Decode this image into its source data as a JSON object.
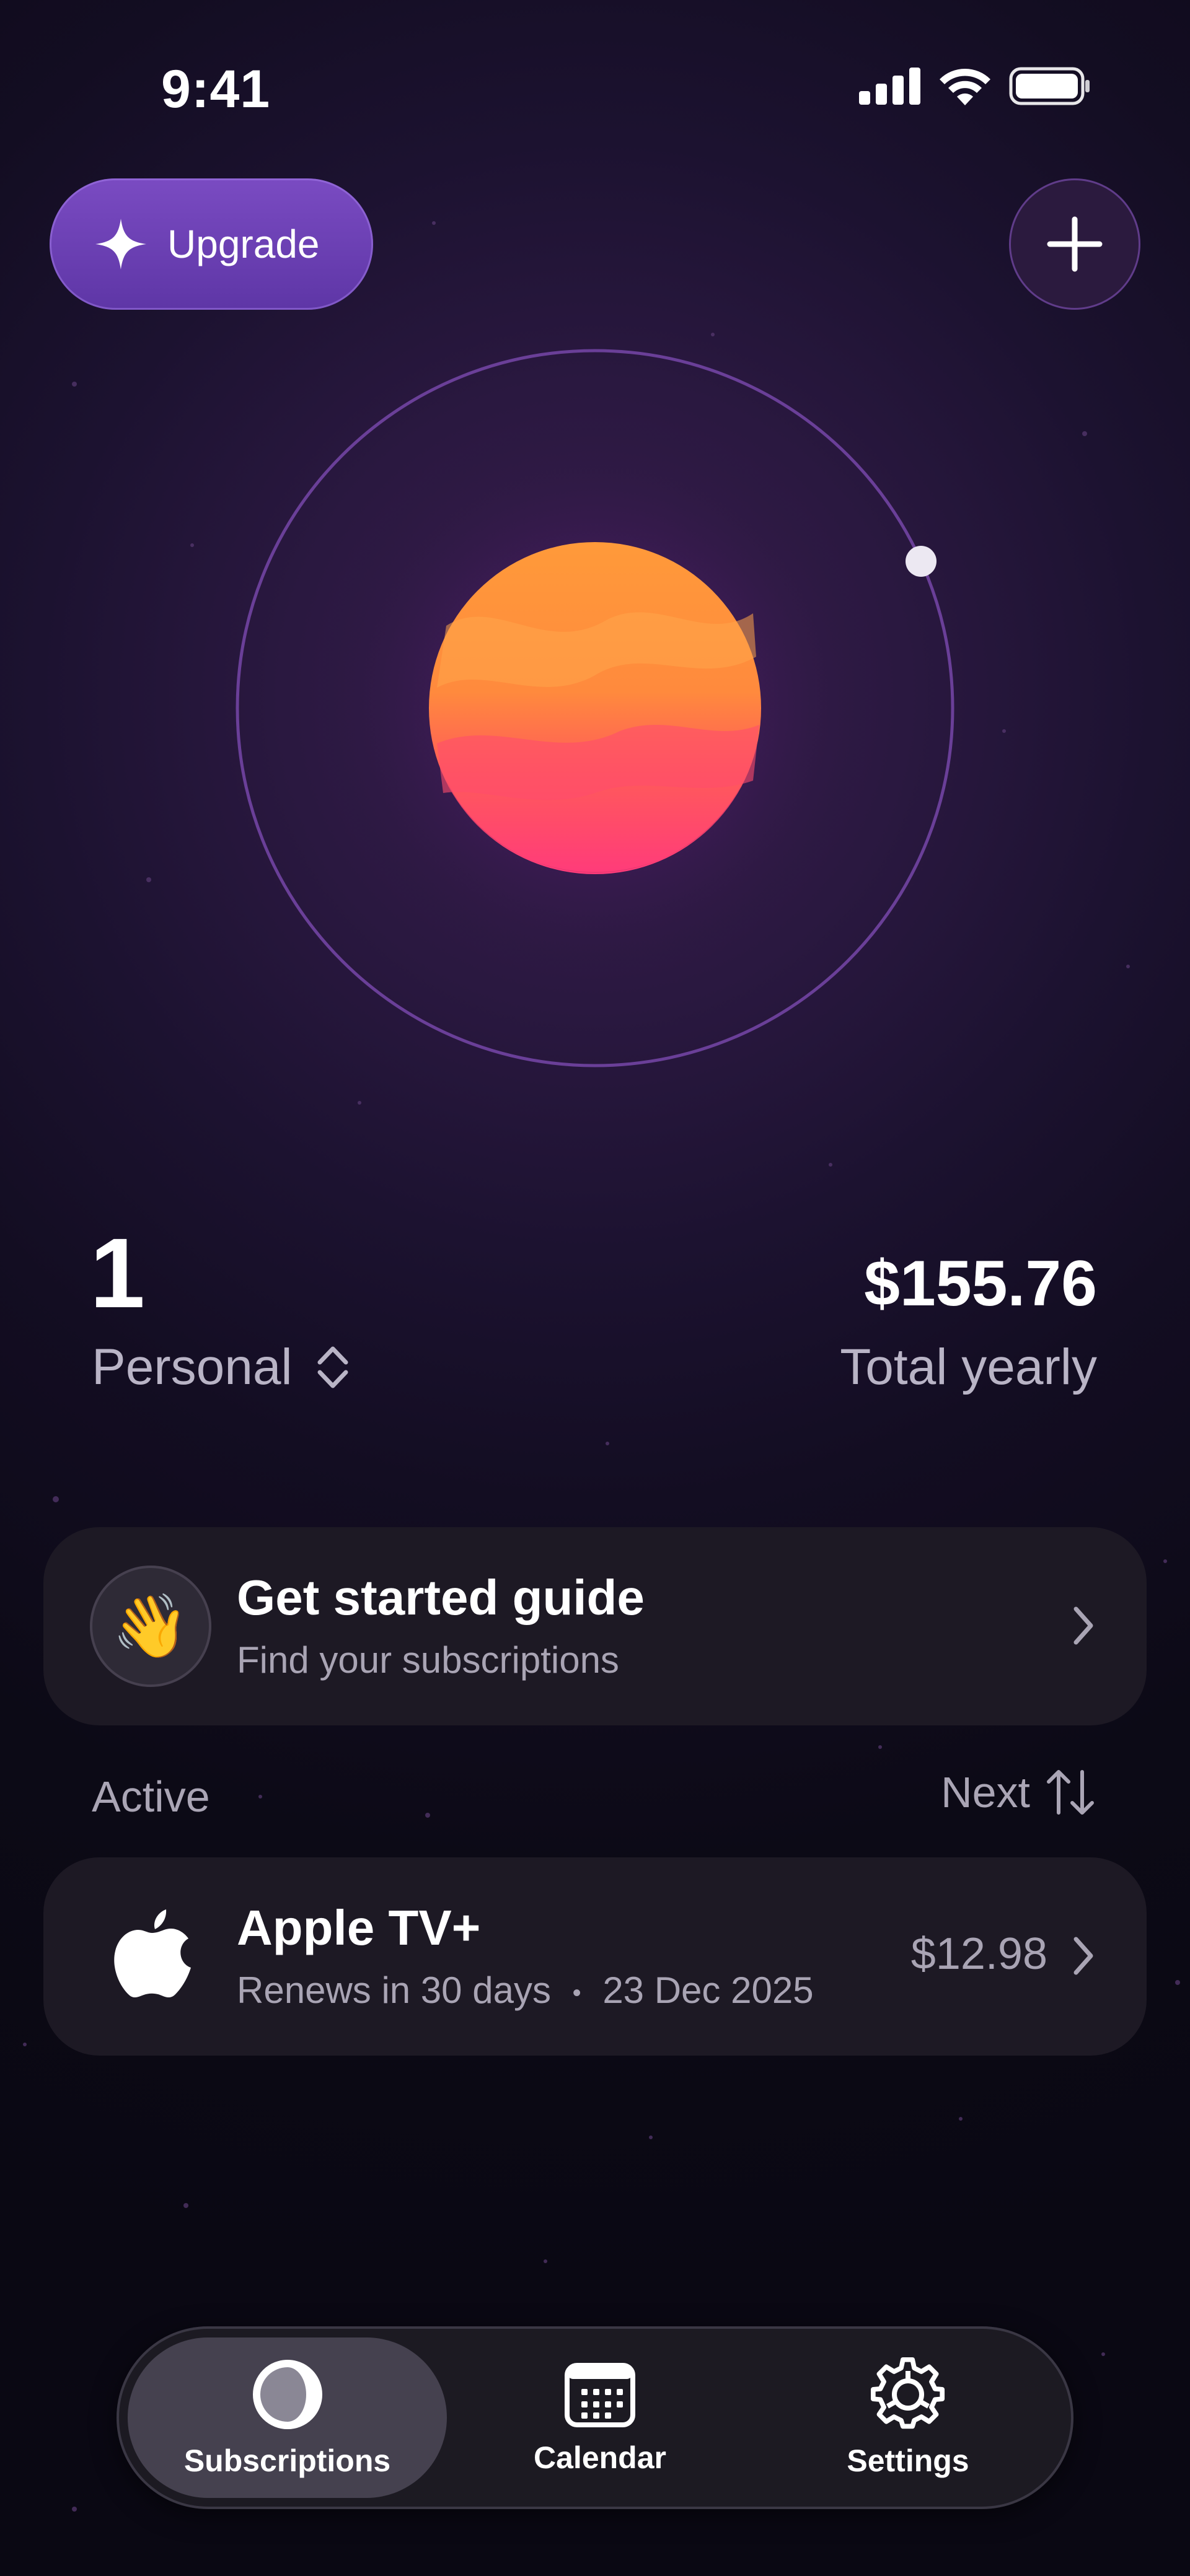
{
  "status_bar": {
    "time": "9:41"
  },
  "header": {
    "upgrade_label": "Upgrade"
  },
  "summary": {
    "count": "1",
    "workspace": "Personal",
    "total": "$155.76",
    "total_label": "Total yearly"
  },
  "guide": {
    "title": "Get started guide",
    "subtitle": "Find your subscriptions",
    "emoji": "👋"
  },
  "list": {
    "section_label": "Active",
    "sort_label": "Next"
  },
  "subscriptions": [
    {
      "name": "Apple TV+",
      "renews": "Renews in 30 days",
      "separator": "•",
      "date": "23 Dec 2025",
      "price": "$12.98"
    }
  ],
  "tabs": [
    {
      "label": "Subscriptions",
      "icon": "moon-phase-icon",
      "selected": true
    },
    {
      "label": "Calendar",
      "icon": "calendar-icon",
      "selected": false
    },
    {
      "label": "Settings",
      "icon": "gear-icon",
      "selected": false
    }
  ],
  "colors": {
    "accent": "#6c40b5",
    "planet_top": "#ff9a3a",
    "planet_bottom": "#ff3b7a",
    "background": "#0c0a16"
  }
}
